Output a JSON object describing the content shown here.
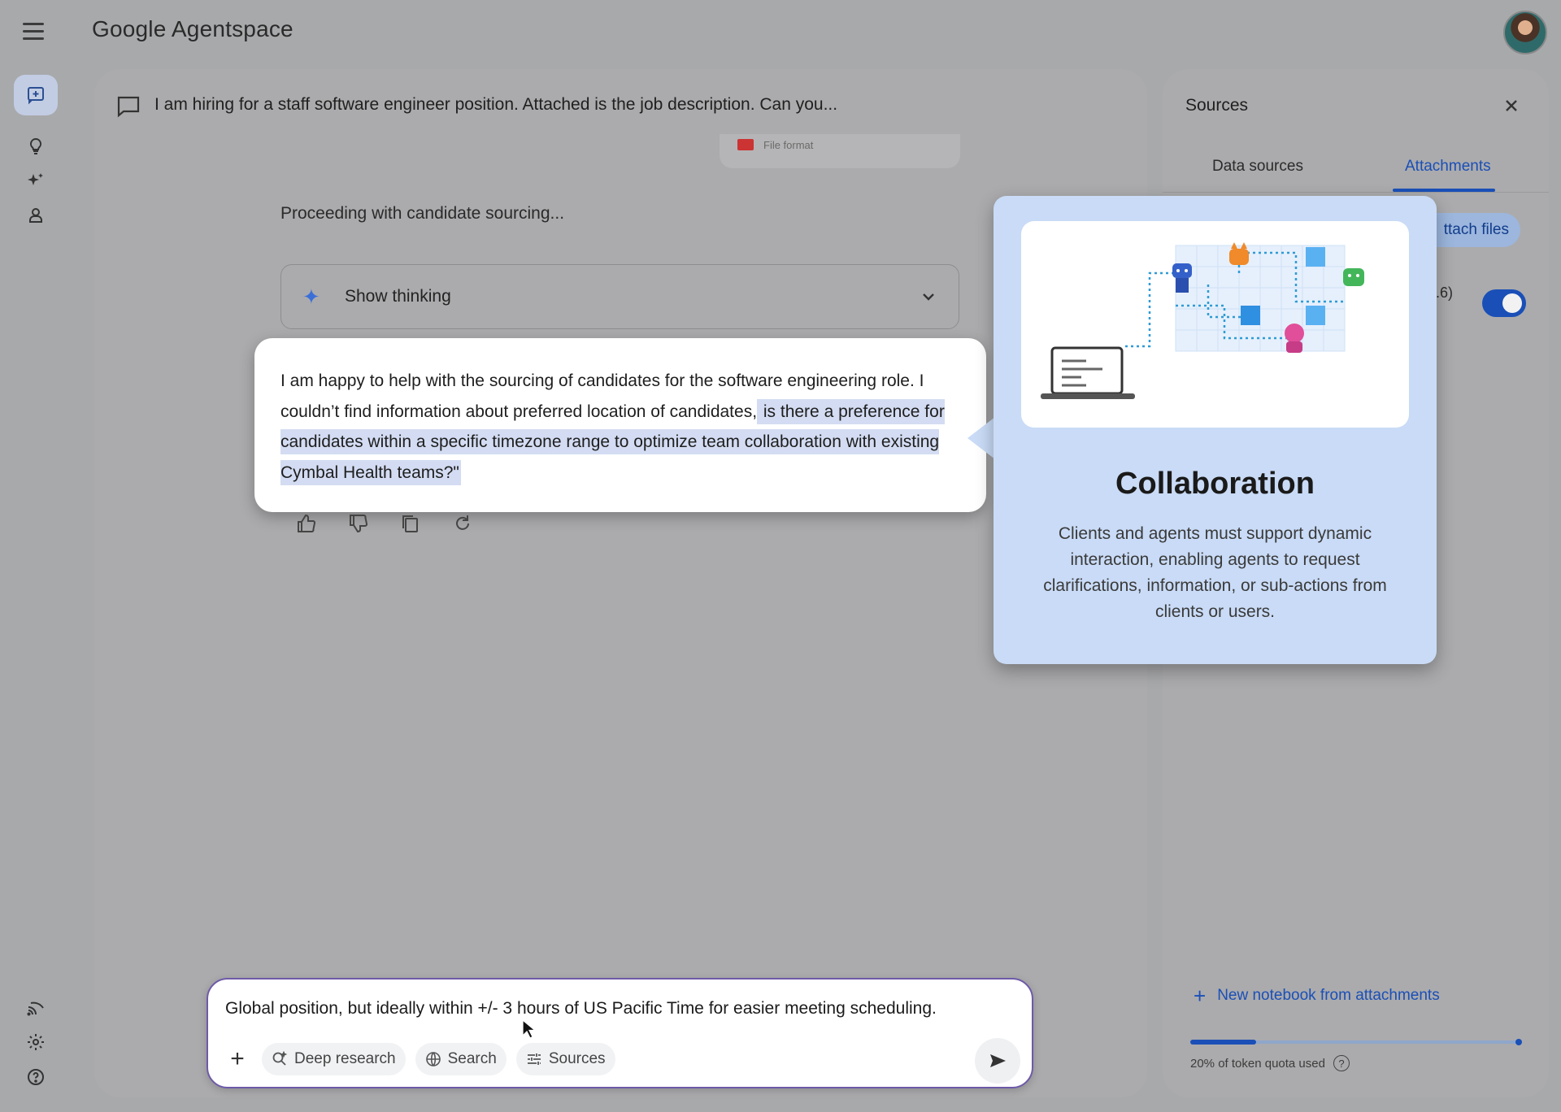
{
  "app": {
    "brand": "Google Agentspace"
  },
  "left_rail": {
    "items": [
      {
        "icon": "new-chat-icon"
      },
      {
        "icon": "lightbulb-icon"
      },
      {
        "icon": "sparkle-agents-icon"
      },
      {
        "icon": "person-icon"
      },
      {
        "icon": "cast-icon"
      },
      {
        "icon": "settings-gear-icon"
      },
      {
        "icon": "help-icon"
      }
    ]
  },
  "chat": {
    "title": "I am hiring for a staff software engineer position. Attached is the job description. Can you...",
    "file_chip_label": "File format",
    "proceeding_text": "Proceeding with candidate sourcing...",
    "show_thinking_label": "Show thinking",
    "answer": {
      "plain": "I am happy to help with the sourcing of candidates for the software engineering role. I couldn’t find information about preferred location of candidates,",
      "highlighted": " is there a preference for candidates within a specific timezone range to optimize team collaboration with existing Cymbal Health teams?\""
    }
  },
  "composer": {
    "value": "Global position, but ideally within +/- 3 hours of US Pacific Time for easier meeting scheduling.",
    "tools": {
      "deep_research": "Deep research",
      "search": "Search",
      "sources": "Sources"
    }
  },
  "sources_panel": {
    "title": "Sources",
    "tabs": {
      "data_sources": "Data sources",
      "attachments": "Attachments"
    },
    "active_tab": "Attachments",
    "attach_files_label": "ttach files",
    "attachment_row_tail": ".6)",
    "attachment_toggle_on": true,
    "new_notebook_label": "New notebook from attachments",
    "quota_text": "20% of token quota used",
    "quota_used_fraction": 0.2
  },
  "popover": {
    "title": "Collaboration",
    "description": "Clients and agents must support dynamic interaction, enabling agents to request clarifications, information, or sub-actions from clients or users."
  },
  "colors": {
    "accent_blue": "#1a4fb7",
    "popover_bg": "#c9dbf6",
    "highlight": "#d3dcf2"
  }
}
